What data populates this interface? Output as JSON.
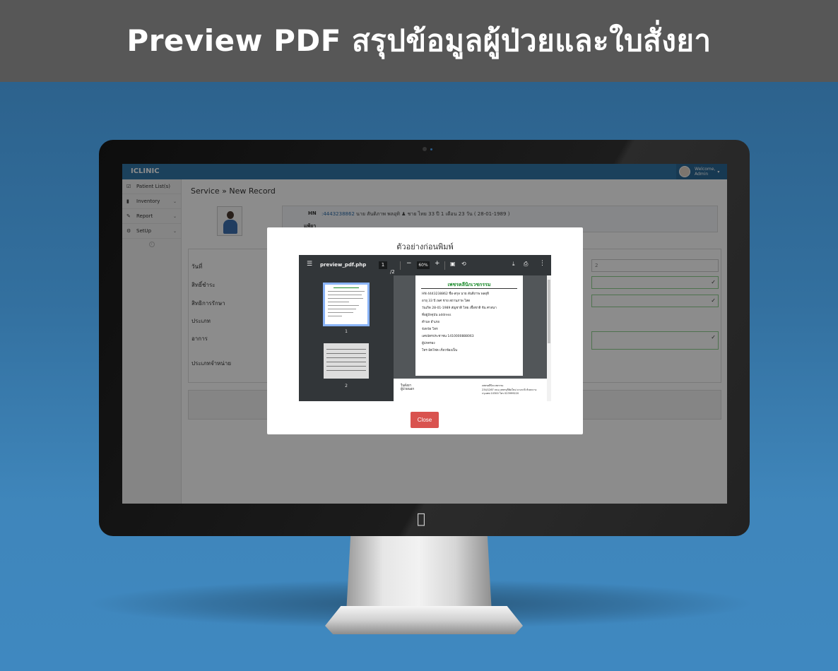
{
  "banner": {
    "title": "Preview PDF สรุปข้อมูลผู้ป่วยและใบสั่งยา"
  },
  "app": {
    "brand": "ICLINIC",
    "user": {
      "line1": "Welcome,",
      "line2": "Admin"
    },
    "sidebar": [
      {
        "label": "Patient List(s)",
        "icon": "check-square-icon"
      },
      {
        "label": "Inventory",
        "icon": "file-icon"
      },
      {
        "label": "Report",
        "icon": "edit-icon"
      },
      {
        "label": "SetUp",
        "icon": "gear-icon"
      }
    ],
    "page_title": "Service » New Record",
    "patient": {
      "hn_label": "HN",
      "hn": ":4443238862",
      "name": "นาย สันติภาพ พลอุทิ",
      "details": "ชาย  ไทย  33 ปี 1 เดือน 23 วัน ( 28-01-1989 )",
      "allergy_label": "แพ้ยา"
    },
    "form": {
      "labels": [
        "วันที่",
        "สิทธิ์ชำระ",
        "สิทธิการรักษา",
        "ประเภท",
        "อาการ",
        "ประเภทจำหน่าย"
      ],
      "date_value": "2"
    }
  },
  "modal": {
    "title": "ตัวอย่างก่อนพิมพ์",
    "close_label": "Close",
    "viewer": {
      "filename": "preview_pdf.php",
      "page_current": "1",
      "page_sep": "/",
      "page_total": "2",
      "zoom": "60%",
      "thumb_labels": [
        "1",
        "2"
      ]
    },
    "pdf": {
      "clinic": "เพชรคลีนิกเวชกรรม",
      "lines": [
        "HN 4443238862      ชื่อ-สกุล นาย สันติภาพ พลอุทิ",
        "อายุ 33 ปี               เพศ ชาย      สถานภาพ โสด",
        "วันเกิด 28-01-1989   สัญชาติ ไทย  เชื้อชาติ จีน  ศาสนา",
        "ที่อยู่ปัจจุบัน         address",
        "ตำบล                                         อำเภอ",
        "จังหวัด                                       โทร",
        "เลขบัตรประชาชน 1410000888063",
        "ผู้ปกครอง",
        "โทร 8ต่7ต่ด                            เกี่ยวข้องเป็น"
      ],
      "page2_left": "ใบสั่งยา\nผู้ป่วยนอก",
      "page2_right": "เพชรคลีนิกเวชกรรม\n234/1267 ถนน เพชรบุรีตัดใหม่ บางกะปิ ห้วยขวาง\nกรุงเทพ 10300 โทร 023999220"
    }
  }
}
